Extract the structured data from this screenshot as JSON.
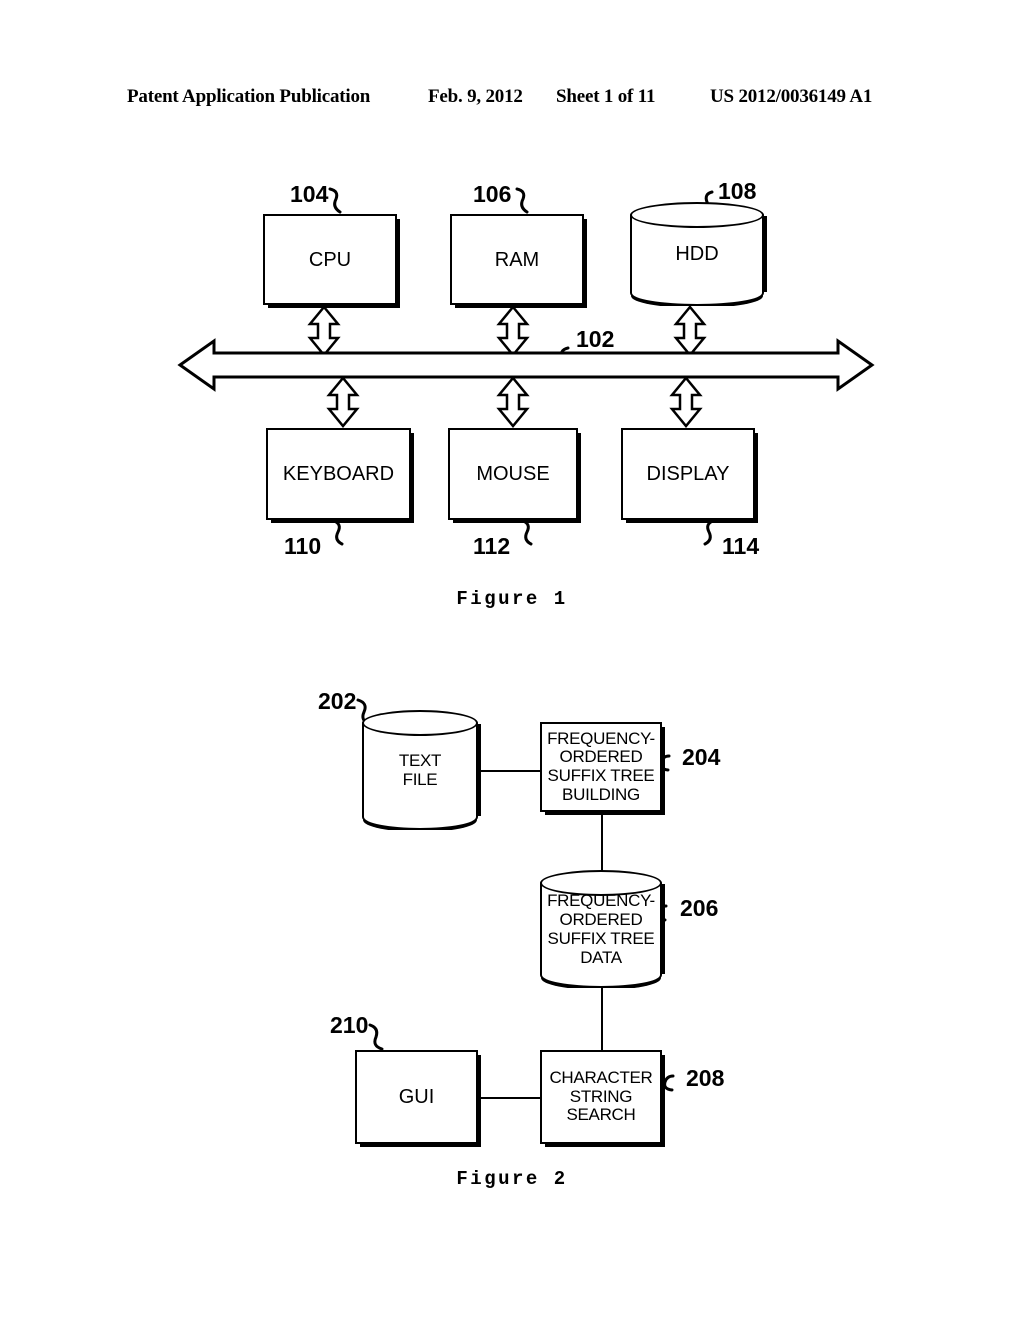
{
  "header": {
    "publication": "Patent Application Publication",
    "date": "Feb. 9, 2012",
    "sheet": "Sheet 1 of 11",
    "patent_number": "US 2012/0036149 A1"
  },
  "figure1": {
    "caption": "Figure 1",
    "nodes": [
      {
        "id": "cpu",
        "label": "CPU",
        "ref": "104",
        "shape": "box"
      },
      {
        "id": "ram",
        "label": "RAM",
        "ref": "106",
        "shape": "box"
      },
      {
        "id": "hdd",
        "label": "HDD",
        "ref": "108",
        "shape": "cylinder"
      },
      {
        "id": "bus",
        "label": "",
        "ref": "102",
        "shape": "bus-arrow"
      },
      {
        "id": "keyboard",
        "label": "KEYBOARD",
        "ref": "110",
        "shape": "box"
      },
      {
        "id": "mouse",
        "label": "MOUSE",
        "ref": "112",
        "shape": "box"
      },
      {
        "id": "display",
        "label": "DISPLAY",
        "ref": "114",
        "shape": "box"
      }
    ]
  },
  "figure2": {
    "caption": "Figure 2",
    "nodes": [
      {
        "id": "text_file",
        "label": "TEXT\nFILE",
        "ref": "202",
        "shape": "cylinder"
      },
      {
        "id": "fost_build",
        "label": "FREQUENCY-\nORDERED\nSUFFIX TREE\nBUILDING",
        "ref": "204",
        "shape": "box"
      },
      {
        "id": "fost_data",
        "label": "FREQUENCY-\nORDERED\nSUFFIX TREE\nDATA",
        "ref": "206",
        "shape": "cylinder"
      },
      {
        "id": "char_search",
        "label": "CHARACTER\nSTRING\nSEARCH",
        "ref": "208",
        "shape": "box"
      },
      {
        "id": "gui",
        "label": "GUI",
        "ref": "210",
        "shape": "box"
      }
    ]
  },
  "colors": {
    "ink": "#000000",
    "paper": "#ffffff"
  }
}
